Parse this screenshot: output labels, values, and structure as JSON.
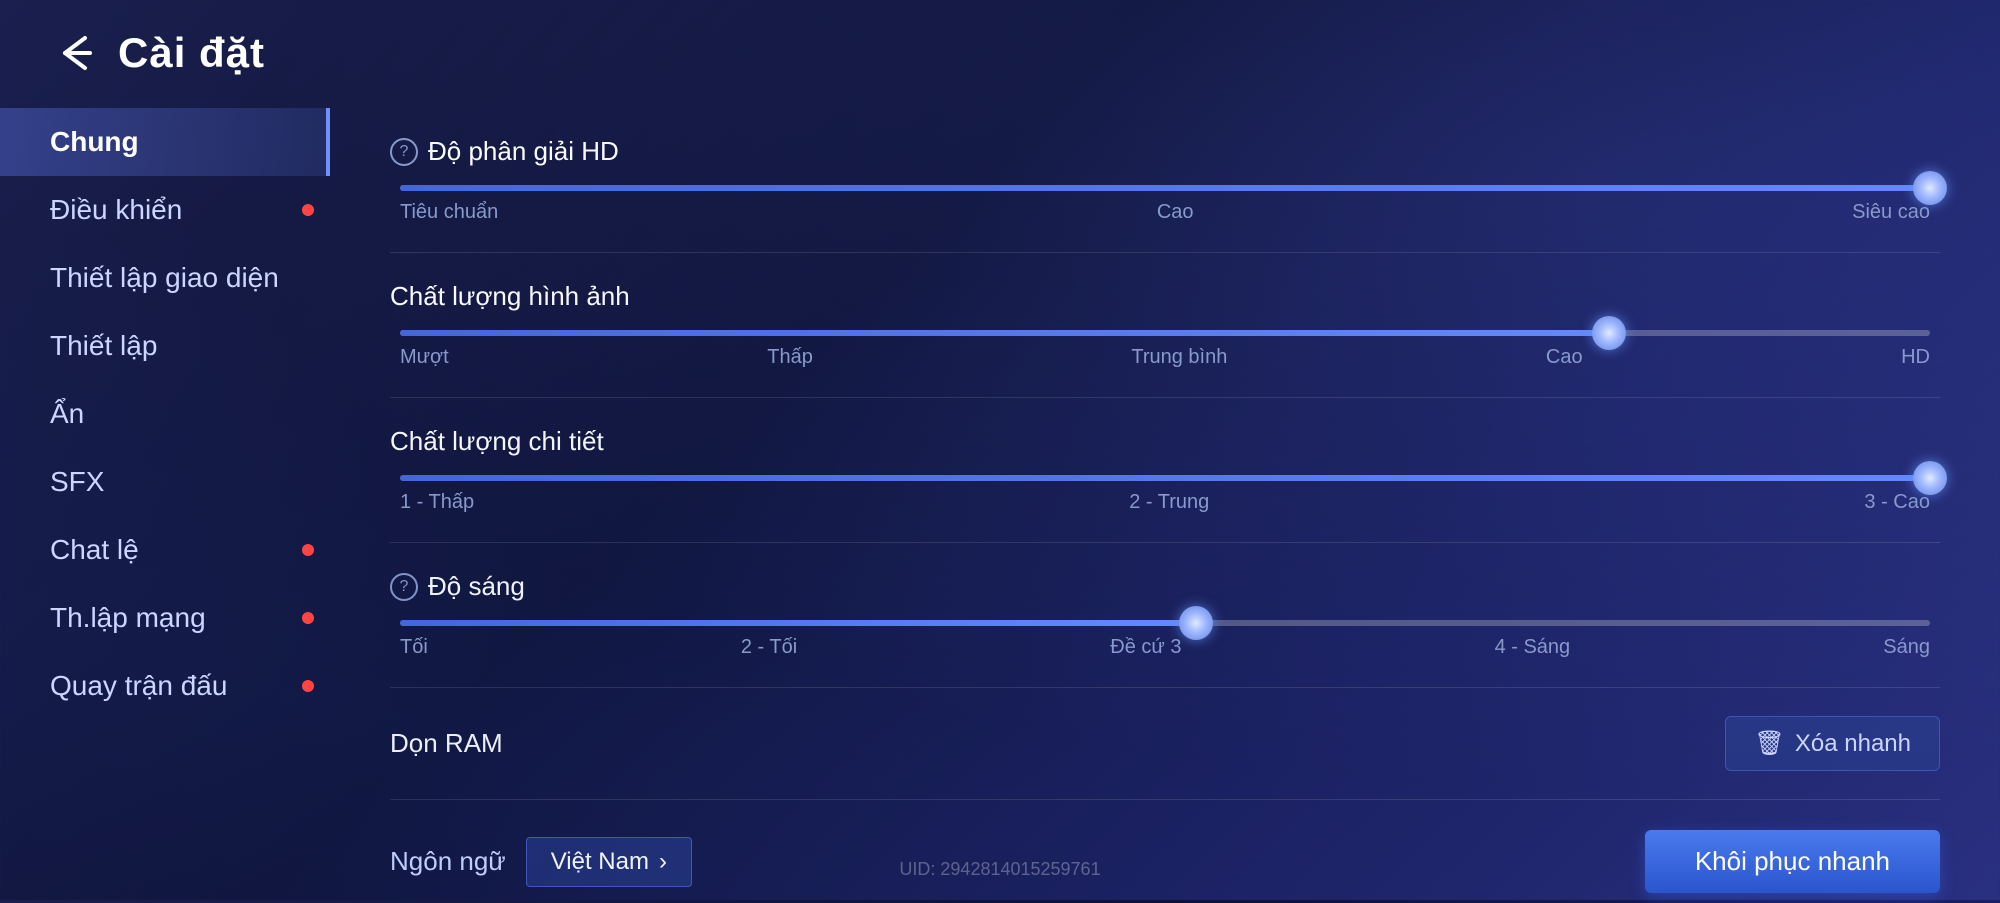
{
  "header": {
    "title": "Cài đặt",
    "icon_label": "back-arrow"
  },
  "sidebar": {
    "items": [
      {
        "id": "chung",
        "label": "Chung",
        "active": true,
        "dot": false
      },
      {
        "id": "dieu-khien",
        "label": "Điều khiển",
        "active": false,
        "dot": true
      },
      {
        "id": "thiet-lap-giao-dien",
        "label": "Thiết lập giao diện",
        "active": false,
        "dot": false
      },
      {
        "id": "thiet-lap",
        "label": "Thiết lập",
        "active": false,
        "dot": false
      },
      {
        "id": "an",
        "label": "Ẩn",
        "active": false,
        "dot": false
      },
      {
        "id": "sfx",
        "label": "SFX",
        "active": false,
        "dot": false
      },
      {
        "id": "chat-le",
        "label": "Chat lệ",
        "active": false,
        "dot": true
      },
      {
        "id": "th-lap-mang",
        "label": "Th.lập mạng",
        "active": false,
        "dot": true
      },
      {
        "id": "quay-tran-dau",
        "label": "Quay trận đấu",
        "active": false,
        "dot": true
      }
    ]
  },
  "content": {
    "settings": [
      {
        "id": "do-phan-giai",
        "label": "Độ phân giải HD",
        "has_help": true,
        "slider": {
          "fill_pct": 100,
          "thumb_pct": 100,
          "labels": [
            "Tiêu chuẩn",
            "Cao",
            "Siêu cao"
          ]
        }
      },
      {
        "id": "chat-luong-hinh-anh",
        "label": "Chất lượng hình ảnh",
        "has_help": false,
        "slider": {
          "fill_pct": 79,
          "thumb_pct": 79,
          "labels": [
            "Mượt",
            "Thấp",
            "Trung bình",
            "Cao",
            "HD"
          ]
        }
      },
      {
        "id": "chat-luong-chi-tiet",
        "label": "Chất lượng chi tiết",
        "has_help": false,
        "slider": {
          "fill_pct": 100,
          "thumb_pct": 100,
          "labels": [
            "1 - Thấp",
            "2 - Trung",
            "3 - Cao"
          ]
        }
      },
      {
        "id": "do-sang",
        "label": "Độ sáng",
        "has_help": true,
        "slider": {
          "fill_pct": 52,
          "thumb_pct": 52,
          "labels": [
            "Tối",
            "2 - Tối",
            "Đề cứ 3",
            "4 - Sáng",
            "Sáng"
          ]
        }
      }
    ],
    "ram_row": {
      "label": "Dọn RAM",
      "button_label": "Xóa nhanh",
      "button_icon": "trash-icon"
    },
    "footer": {
      "language_label": "Ngôn ngữ",
      "language_value": "Việt Nam",
      "language_arrow": "›",
      "restore_button": "Khôi phục nhanh",
      "uid": "UID: 2942814015259761"
    }
  }
}
